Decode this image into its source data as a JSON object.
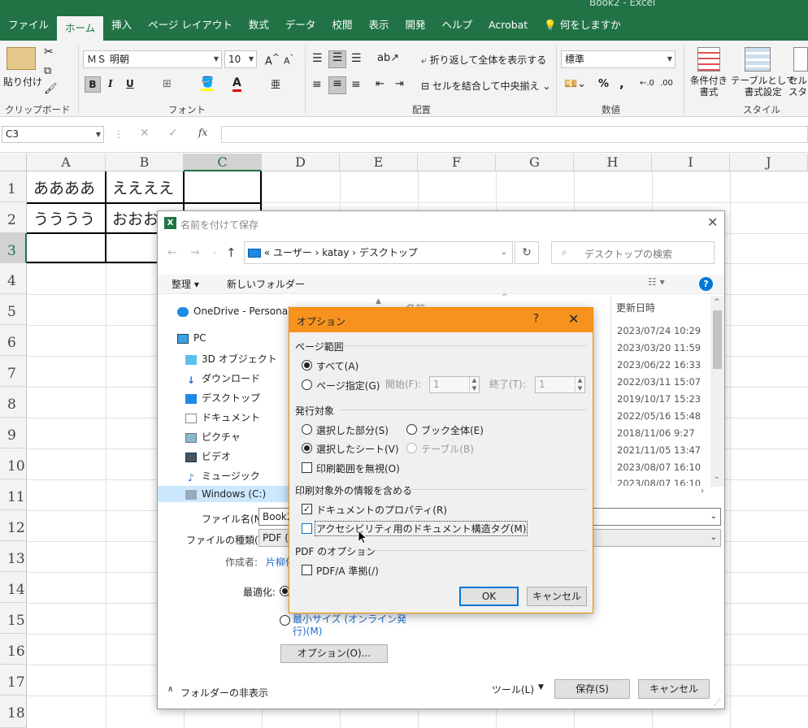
{
  "window": {
    "title": "Book2 - Excel"
  },
  "ribbon_tabs": [
    "ファイル",
    "ホーム",
    "挿入",
    "ページ レイアウト",
    "数式",
    "データ",
    "校閲",
    "表示",
    "開発",
    "ヘルプ",
    "Acrobat"
  ],
  "tell_me": "何をしますか",
  "clipboard": {
    "paste": "貼り付け",
    "label": "クリップボード"
  },
  "font": {
    "name": "ＭＳ 明朝",
    "size": "10",
    "label": "フォント",
    "bold": "B",
    "italic": "I",
    "underline": "U"
  },
  "alignment": {
    "wrap": "折り返して全体を表示する",
    "merge": "セルを結合して中央揃え",
    "label": "配置"
  },
  "number": {
    "format": "標準",
    "label": "数値",
    "percent": "%",
    "comma": ","
  },
  "styles": {
    "conditional": "条件付き\n書式",
    "table": "テーブルとして\n書式設定",
    "cell": "セル\nスタイル",
    "label": "スタイル"
  },
  "formula_bar": {
    "name_box": "C3",
    "fx": "fx"
  },
  "columns": [
    "A",
    "B",
    "C",
    "D",
    "E",
    "F",
    "G",
    "H",
    "I",
    "J"
  ],
  "rows": [
    "1",
    "2",
    "3",
    "4",
    "5",
    "6",
    "7",
    "8",
    "9",
    "10",
    "11",
    "12",
    "13",
    "14",
    "15",
    "16",
    "17",
    "18"
  ],
  "cells": {
    "A1": "ああああ",
    "B1": "ええええ",
    "A2": "うううう",
    "B2": "おおおお"
  },
  "save_dialog": {
    "title": "名前を付けて保存",
    "path": [
      "ユーザー",
      "katay",
      "デスクトップ"
    ],
    "search_placeholder": "デスクトップの検索",
    "organize": "整理 ▾",
    "new_folder": "新しいフォルダー",
    "nav": [
      "OneDrive - Personal",
      "PC",
      "3D オブジェクト",
      "ダウンロード",
      "デスクトップ",
      "ドキュメント",
      "ピクチャ",
      "ビデオ",
      "ミュージック",
      "Windows (C:)"
    ],
    "col_name": "名前",
    "col_date": "更新日時",
    "dates": [
      "2023/07/24 10:29",
      "2023/03/20 11:59",
      "2023/06/22 16:33",
      "2022/03/11 15:07",
      "2019/10/17 15:23",
      "2022/05/16 15:48",
      "2018/11/06 9:27",
      "2021/11/05 13:47",
      "2023/08/07 16:10",
      "2023/08/07 16:10"
    ],
    "filename_label": "ファイル名(N):",
    "filename_value": "Book2",
    "filetype_label": "ファイルの種類(T):",
    "filetype_value": "PDF (*",
    "author_label": "作成者:",
    "author_value": "片柳依",
    "optimize_label": "最適化:",
    "min_size": "最小サイズ (オンライン発\n行)(M)",
    "options_btn": "オプション(O)...",
    "hide_folders": "フォルダーの非表示",
    "tools": "ツール(L)",
    "save_btn": "保存(S)",
    "cancel_btn": "キャンセル"
  },
  "options_dialog": {
    "title": "オプション",
    "help": "?",
    "page_range": "ページ範囲",
    "all": "すべて(A)",
    "pages": "ページ指定(G)",
    "from_label": "開始(F):",
    "from_value": "1",
    "to_label": "終了(T):",
    "to_value": "1",
    "publish_what": "発行対象",
    "selection": "選択した部分(S)",
    "entire_workbook": "ブック全体(E)",
    "active_sheets": "選択したシート(V)",
    "table": "テーブル(B)",
    "ignore_print_areas": "印刷範囲を無視(O)",
    "include_nonprinting": "印刷対象外の情報を含める",
    "doc_properties": "ドキュメントのプロパティ(R)",
    "accessibility_tags": "アクセシビリティ用のドキュメント構造タグ(M)",
    "pdf_options": "PDF のオプション",
    "pdfa": "PDF/A 準拠(/)",
    "ok": "OK",
    "cancel": "キャンセル"
  },
  "colors": {
    "excel_green": "#217346",
    "dialog_orange": "#f7921e",
    "accent_blue": "#0078d7"
  }
}
